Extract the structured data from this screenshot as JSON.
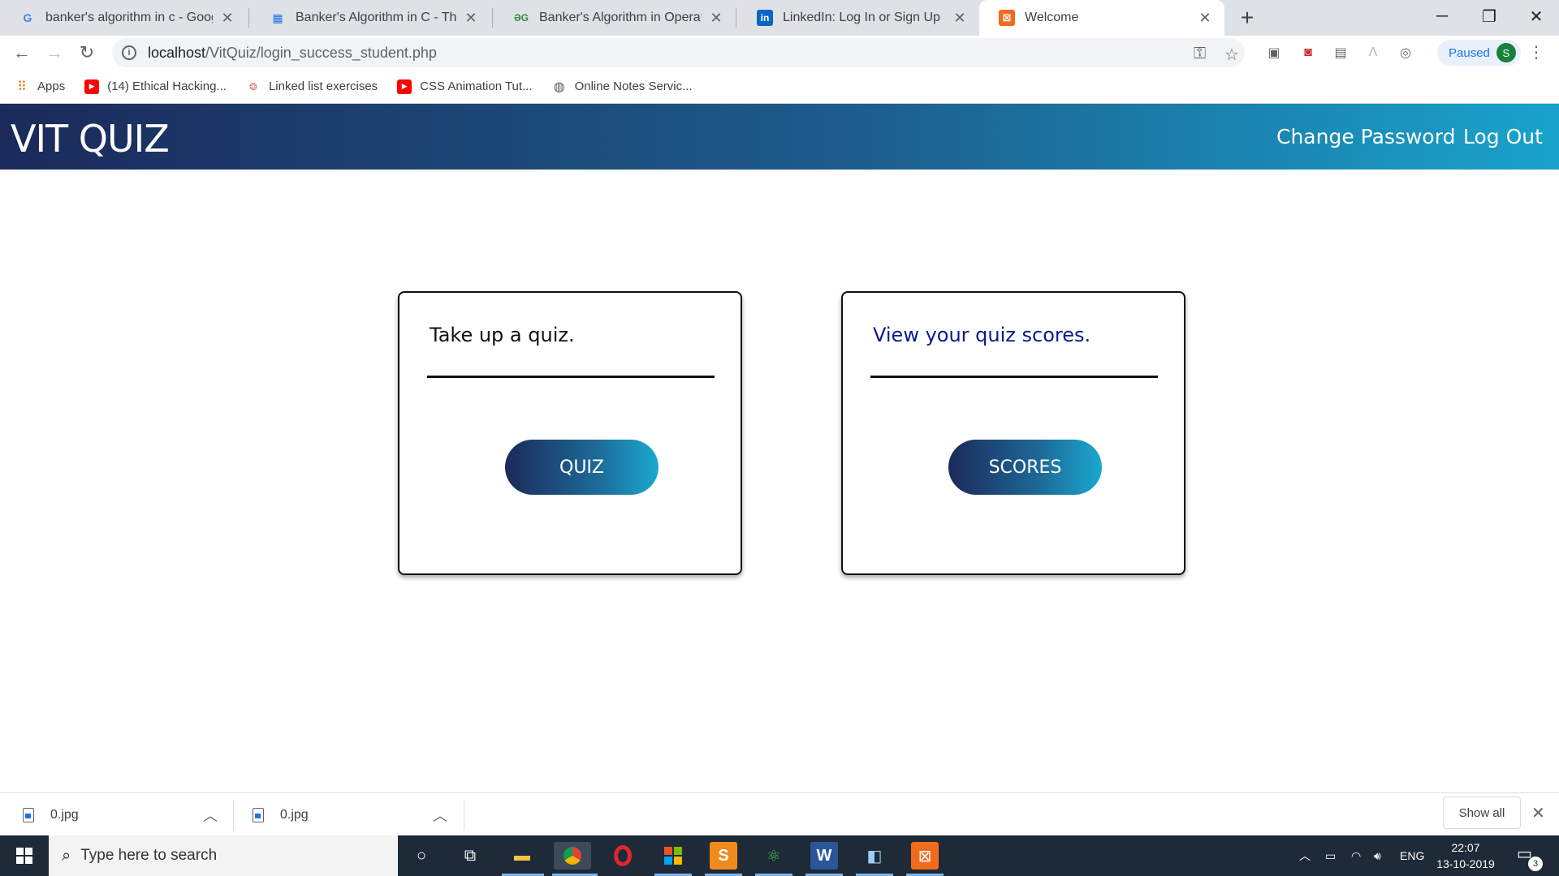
{
  "browser": {
    "tabs": [
      {
        "title": "banker's algorithm in c - Google",
        "favicon": "G",
        "favicon_color": "#4285f4",
        "active": false
      },
      {
        "title": "Banker's Algorithm in C - The Cra",
        "favicon": "▦",
        "favicon_color": "#1a73e8",
        "active": false
      },
      {
        "title": "Banker's Algorithm in Operating",
        "favicon": "ƏG",
        "favicon_color": "#2f8d46",
        "active": false
      },
      {
        "title": "LinkedIn: Log In or Sign Up",
        "favicon": "in",
        "favicon_color": "#0a66c2",
        "active": false
      },
      {
        "title": "Welcome",
        "favicon": "⊠",
        "favicon_color": "#f26b1d",
        "active": true
      }
    ],
    "url_host": "localhost",
    "url_path": "/VitQuiz/login_success_student.php",
    "profile_status": "Paused",
    "profile_initial": "S",
    "bookmarks": [
      {
        "label": "Apps",
        "icon": "apps-grid-icon"
      },
      {
        "label": "(14) Ethical Hacking...",
        "icon": "youtube-icon"
      },
      {
        "label": "Linked list exercises",
        "icon": "site-icon"
      },
      {
        "label": "CSS Animation Tut...",
        "icon": "youtube-icon"
      },
      {
        "label": "Online Notes Servic...",
        "icon": "globe-icon"
      }
    ]
  },
  "page": {
    "brand": "VIT QUIZ",
    "nav": {
      "change_password": "Change Password",
      "logout": "Log Out"
    },
    "cards": [
      {
        "title": "Take up a quiz.",
        "title_color": "#111111",
        "button": "QUIZ"
      },
      {
        "title": "View your quiz scores.",
        "title_color": "#0a1a8a",
        "button": "SCORES"
      }
    ],
    "colors": {
      "header_start": "#1b2a5a",
      "header_end": "#19a3cc"
    }
  },
  "downloads": {
    "items": [
      {
        "name": "0.jpg"
      },
      {
        "name": "0.jpg"
      }
    ],
    "show_all": "Show all"
  },
  "taskbar": {
    "search_placeholder": "Type here to search",
    "language": "ENG",
    "time": "22:07",
    "date": "13-10-2019",
    "notification_count": "3"
  }
}
